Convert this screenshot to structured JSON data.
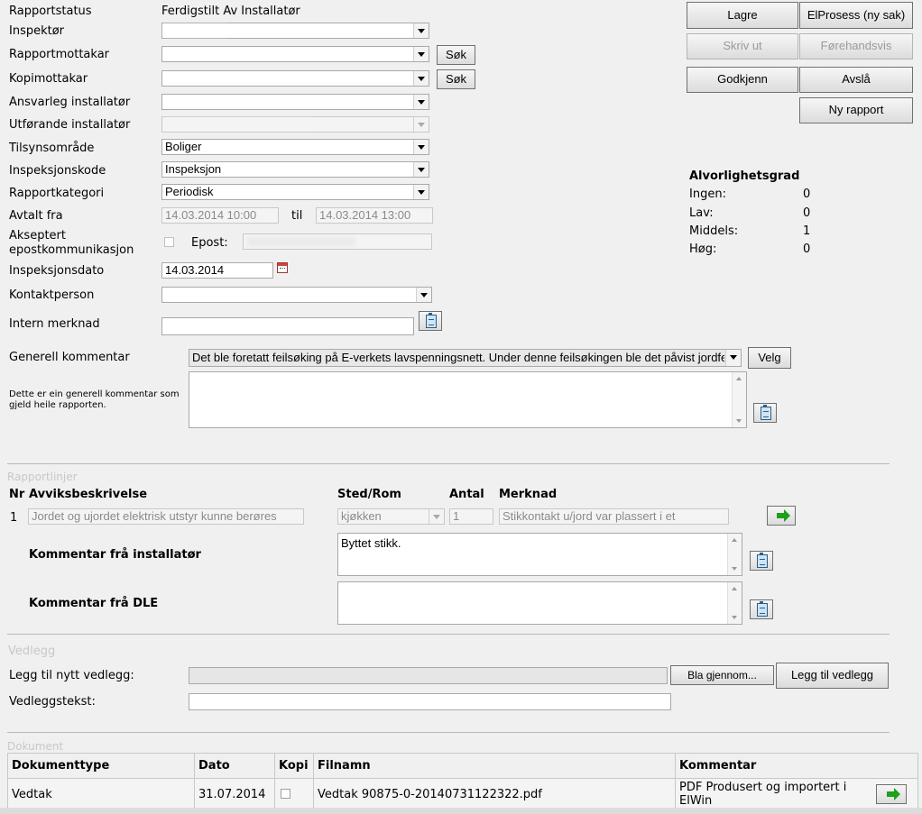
{
  "form": {
    "rapportstatus": {
      "label": "Rapportstatus",
      "value": "Ferdigstilt Av Installatør"
    },
    "inspektor": {
      "label": "Inspektør"
    },
    "rapportmottakar": {
      "label": "Rapportmottakar"
    },
    "kopimottakar": {
      "label": "Kopimottakar"
    },
    "ansvarleg": {
      "label": "Ansvarleg installatør"
    },
    "utforande": {
      "label": "Utførande installatør"
    },
    "tilsynsomrade": {
      "label": "Tilsynsområde",
      "value": "Boliger"
    },
    "inspeksjonskode": {
      "label": "Inspeksjonskode",
      "value": "Inspeksjon"
    },
    "rapportkategori": {
      "label": "Rapportkategori",
      "value": "Periodisk"
    },
    "avtalt": {
      "label": "Avtalt fra",
      "from": "14.03.2014 10:00",
      "til_label": "til",
      "to": "14.03.2014 13:00"
    },
    "akseptert": {
      "label_line1": "Akseptert",
      "label_line2": "epostkommunikasjon",
      "epost_label": "Epost:"
    },
    "inspeksjonsdato": {
      "label": "Inspeksjonsdato",
      "value": "14.03.2014"
    },
    "kontaktperson": {
      "label": "Kontaktperson"
    },
    "intern_merknad": {
      "label": "Intern merknad"
    },
    "generell": {
      "label": "Generell kommentar",
      "selected": "Det ble foretatt feilsøking på E-verkets lavspenningsnett. Under denne feilsøkingen ble det påvist jordfeil",
      "hint": "Dette er ein generell kommentar som gjeld heile rapporten.",
      "velg": "Velg"
    },
    "sok": "Søk"
  },
  "actions": {
    "lagre": "Lagre",
    "elprosess": "ElProsess (ny sak)",
    "skriv_ut": "Skriv ut",
    "forehandsvis": "Førehandsvis",
    "godkjenn": "Godkjenn",
    "avsla": "Avslå",
    "ny_rapport": "Ny rapport"
  },
  "severity": {
    "title": "Alvorlighetsgrad",
    "rows": [
      {
        "label": "Ingen:",
        "value": "0"
      },
      {
        "label": "Lav:",
        "value": "0"
      },
      {
        "label": "Middels:",
        "value": "1"
      },
      {
        "label": "Høg:",
        "value": "0"
      }
    ]
  },
  "rapportlinjer": {
    "section": "Rapportlinjer",
    "headers": {
      "nr": "Nr",
      "avvik": "Avviksbeskrivelse",
      "sted": "Sted/Rom",
      "antal": "Antal",
      "merknad": "Merknad"
    },
    "row": {
      "nr": "1",
      "avvik": "Jordet og ujordet elektrisk utstyr kunne berøres",
      "sted": "kjøkken",
      "antal": "1",
      "merknad": "Stikkontakt u/jord var plassert i et"
    },
    "kommentar_installator": {
      "label": "Kommentar frå installatør",
      "value": "Byttet stikk."
    },
    "kommentar_dle": {
      "label": "Kommentar frå DLE",
      "value": ""
    }
  },
  "vedlegg": {
    "section": "Vedlegg",
    "nytt_label": "Legg til nytt vedlegg:",
    "bla": "Bla gjennom...",
    "legg_til": "Legg til vedlegg",
    "tekst_label": "Vedleggstekst:"
  },
  "dokument": {
    "section": "Dokument",
    "headers": [
      "Dokumenttype",
      "Dato",
      "Kopi",
      "Filnamn",
      "Kommentar"
    ],
    "rows": [
      {
        "type": "Vedtak",
        "dato": "31.07.2014",
        "filnamn": "Vedtak 90875-0-20140731122322.pdf",
        "kommentar": "PDF Produsert og importert i ElWin"
      }
    ]
  }
}
